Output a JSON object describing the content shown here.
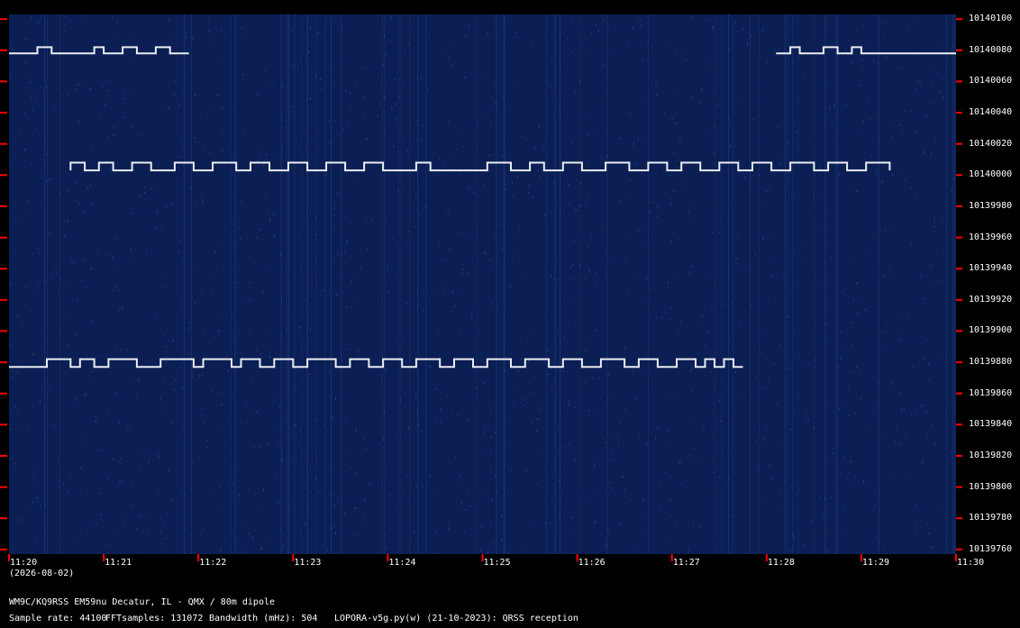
{
  "chart_data": {
    "type": "heatmap",
    "subtype": "spectrogram-waterfall",
    "x_unit": "time (hh:mm)",
    "y_unit": "frequency (Hz)",
    "x_ticks": [
      "11:20",
      "11:21",
      "11:22",
      "11:23",
      "11:24",
      "11:25",
      "11:26",
      "11:27",
      "11:28",
      "11:29",
      "11:30"
    ],
    "y_ticks": [
      10140100,
      10140080,
      10140060,
      10140040,
      10140020,
      10140000,
      10139980,
      10139960,
      10139940,
      10139920,
      10139900,
      10139880,
      10139860,
      10139840,
      10139820,
      10139800,
      10139780,
      10139760
    ],
    "date_label": "(2026-08-02)",
    "xlim_minutes": [
      0,
      10
    ],
    "ylim": [
      10139757,
      10140103
    ],
    "colors": {
      "background": "#0b1f55",
      "signal": "#ffffff",
      "tick": "#ff0000",
      "noise": "#3c70c8"
    },
    "series": [
      {
        "signal": "trace-a",
        "start_minute": 0.0,
        "end_minute": 7.75,
        "base_freq": 10139877,
        "high_freq": 10139882,
        "high_segments": [
          [
            0.4,
            0.65
          ],
          [
            0.75,
            0.9
          ],
          [
            1.05,
            1.35
          ],
          [
            1.6,
            1.95
          ],
          [
            2.05,
            2.35
          ],
          [
            2.45,
            2.65
          ],
          [
            2.8,
            3.0
          ],
          [
            3.15,
            3.45
          ],
          [
            3.6,
            3.8
          ],
          [
            3.95,
            4.15
          ],
          [
            4.3,
            4.55
          ],
          [
            4.7,
            4.9
          ],
          [
            5.05,
            5.3
          ],
          [
            5.45,
            5.7
          ],
          [
            5.85,
            6.05
          ],
          [
            6.25,
            6.5
          ],
          [
            6.65,
            6.85
          ],
          [
            7.05,
            7.25
          ],
          [
            7.35,
            7.45
          ],
          [
            7.55,
            7.65
          ]
        ]
      },
      {
        "signal": "trace-b",
        "start_minute": 0.65,
        "end_minute": 9.3,
        "base_freq": 10140003,
        "high_freq": 10140008,
        "high_segments": [
          [
            0.65,
            0.8
          ],
          [
            0.95,
            1.1
          ],
          [
            1.3,
            1.5
          ],
          [
            1.75,
            1.95
          ],
          [
            2.15,
            2.4
          ],
          [
            2.55,
            2.75
          ],
          [
            2.95,
            3.15
          ],
          [
            3.35,
            3.55
          ],
          [
            3.75,
            3.95
          ],
          [
            4.3,
            4.45
          ],
          [
            5.05,
            5.3
          ],
          [
            5.5,
            5.65
          ],
          [
            5.85,
            6.05
          ],
          [
            6.3,
            6.55
          ],
          [
            6.75,
            6.95
          ],
          [
            7.1,
            7.3
          ],
          [
            7.5,
            7.7
          ],
          [
            7.85,
            8.05
          ],
          [
            8.25,
            8.5
          ],
          [
            8.65,
            8.85
          ],
          [
            9.05,
            9.3
          ]
        ]
      },
      {
        "signal": "trace-c-left",
        "start_minute": 0.0,
        "end_minute": 1.9,
        "base_freq": 10140078,
        "high_freq": 10140082,
        "high_segments": [
          [
            0.3,
            0.45
          ],
          [
            0.9,
            1.0
          ],
          [
            1.2,
            1.35
          ],
          [
            1.55,
            1.7
          ]
        ]
      },
      {
        "signal": "trace-c-right",
        "start_minute": 8.1,
        "end_minute": 10.0,
        "base_freq": 10140078,
        "high_freq": 10140082,
        "high_segments": [
          [
            8.25,
            8.35
          ],
          [
            8.6,
            8.75
          ],
          [
            8.9,
            9.0
          ]
        ]
      }
    ]
  },
  "footer": {
    "station": "WM9C/KQ9RSS EM59nu Decatur, IL - QMX / 80m dipole",
    "sample_rate": "Sample rate: 44100",
    "fft_samples": "FFTsamples: 131072",
    "bandwidth": "Bandwidth (mHz): 504",
    "software": "LOPORA-v5g.py(w) (21-10-2023): QRSS reception"
  }
}
